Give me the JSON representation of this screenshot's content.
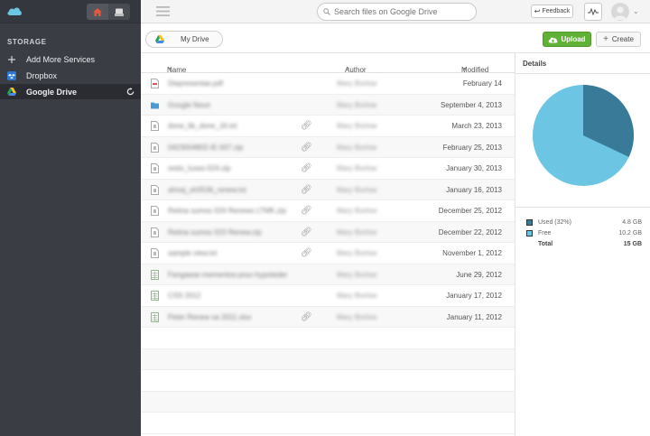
{
  "sidebar": {
    "section_title": "STORAGE",
    "items": [
      {
        "label": "Add More Services",
        "icon": "plus-icon"
      },
      {
        "label": "Dropbox",
        "icon": "dropbox-icon"
      },
      {
        "label": "Google Drive",
        "icon": "google-drive-icon",
        "active": true
      }
    ]
  },
  "topbar": {
    "search_placeholder": "Search files on Google Drive",
    "feedback_label": "Feedback"
  },
  "toolbar": {
    "breadcrumb": "My Drive",
    "upload_label": "Upload",
    "create_label": "Create"
  },
  "filelist": {
    "columns": {
      "name": "Name",
      "author": "Author",
      "modified": "Modified"
    },
    "rows": [
      {
        "name": "Diapresentae.pdf",
        "type": "pdf",
        "shared": false,
        "author": "Mary Borlow",
        "modified": "February 14"
      },
      {
        "name": "Google Noun",
        "type": "folder",
        "shared": false,
        "author": "Mary Borlow",
        "modified": "September 4, 2013"
      },
      {
        "name": "done_lib_done_16.txt",
        "type": "file",
        "shared": true,
        "author": "Mary Borlow",
        "modified": "March 23, 2013"
      },
      {
        "name": "0423004802-IE-007.zip",
        "type": "file",
        "shared": true,
        "author": "Mary Borlow",
        "modified": "February 25, 2013"
      },
      {
        "name": "resto_luxes-024.zip",
        "type": "file",
        "shared": true,
        "author": "Mary Borlow",
        "modified": "January 30, 2013"
      },
      {
        "name": "ahnej_sh0536_renew.txt",
        "type": "file",
        "shared": true,
        "author": "Mary Borlow",
        "modified": "January 16, 2013"
      },
      {
        "name": "Retina sumos 024 Renews LTMK.zip",
        "type": "file",
        "shared": true,
        "author": "Mary Borlow",
        "modified": "December 25, 2012"
      },
      {
        "name": "Retina sumos 023 Renew.zip",
        "type": "file",
        "shared": true,
        "author": "Mary Borlow",
        "modified": "December 22, 2012"
      },
      {
        "name": "sample view.txt",
        "type": "file",
        "shared": true,
        "author": "Mary Borlow",
        "modified": "November 1, 2012"
      },
      {
        "name": "Fangawar-mementos-pour-hypoteder",
        "type": "sheet",
        "shared": false,
        "author": "Mary Borlow",
        "modified": "June 29, 2012"
      },
      {
        "name": "CSS 2012",
        "type": "sheet",
        "shared": false,
        "author": "Mary Borlow",
        "modified": "January 17, 2012"
      },
      {
        "name": "Peter Renew sa 2011.xlsx",
        "type": "sheet",
        "shared": true,
        "author": "Mary Borlow",
        "modified": "January 11, 2012"
      }
    ]
  },
  "details": {
    "title": "Details",
    "used_fraction": 0.32,
    "colors": {
      "used": "#3a7a99",
      "free": "#6cc5e3"
    },
    "legend": [
      {
        "label": "Used (32%)",
        "value": "4.8 GB",
        "swatch": "#3a7a99"
      },
      {
        "label": "Free",
        "value": "10.2 GB",
        "swatch": "#6cc5e3"
      },
      {
        "label": "Total",
        "value": "15 GB",
        "swatch": null
      }
    ]
  }
}
